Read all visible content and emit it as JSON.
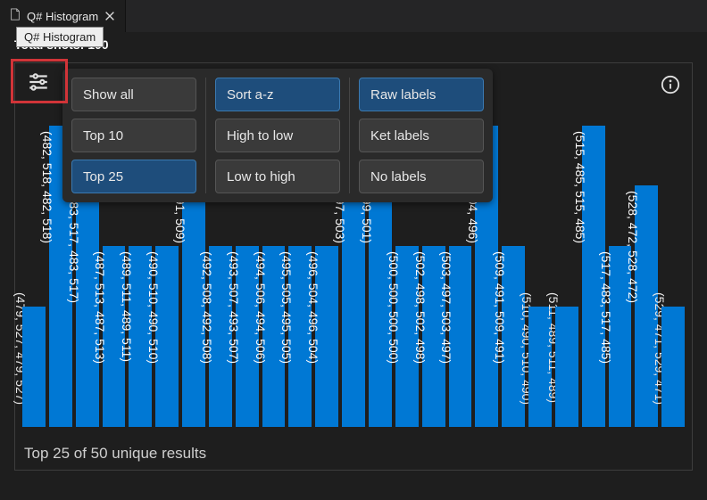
{
  "tab": {
    "title": "Q# Histogram"
  },
  "tooltip": "Q# Histogram",
  "shots_label": "Total shots:",
  "shots_value": "100",
  "panel": {
    "groups": [
      {
        "buttons": [
          {
            "label": "Show all",
            "selected": false,
            "name": "filter-show-all"
          },
          {
            "label": "Top 10",
            "selected": false,
            "name": "filter-top-10"
          },
          {
            "label": "Top 25",
            "selected": true,
            "name": "filter-top-25"
          }
        ]
      },
      {
        "buttons": [
          {
            "label": "Sort a-z",
            "selected": true,
            "name": "sort-az"
          },
          {
            "label": "High to low",
            "selected": false,
            "name": "sort-high-low"
          },
          {
            "label": "Low to high",
            "selected": false,
            "name": "sort-low-high"
          }
        ]
      },
      {
        "buttons": [
          {
            "label": "Raw labels",
            "selected": true,
            "name": "labels-raw"
          },
          {
            "label": "Ket labels",
            "selected": false,
            "name": "labels-ket"
          },
          {
            "label": "No labels",
            "selected": false,
            "name": "labels-none"
          }
        ]
      }
    ]
  },
  "footer": "Top 25 of 50 unique results",
  "chart_data": {
    "type": "bar",
    "title": "Q# Histogram",
    "xlabel": "",
    "ylabel": "",
    "ylim": [
      0,
      5
    ],
    "categories": [
      "(479, 527, 479, 527)",
      "(482, 518, 482, 518)",
      "(483, 517, 483, 517)",
      "(487, 513, 487, 513)",
      "(489, 511, 489, 511)",
      "(490, 510, 490, 510)",
      "(491, 509, 491, 509)",
      "(492, 508, 492, 508)",
      "(493, 507, 493, 507)",
      "(494, 506, 494, 506)",
      "(495, 505, 495, 505)",
      "(496, 504, 496, 504)",
      "(497, 503, 497, 503)",
      "(499, 501, 499, 501)",
      "(500, 500, 500, 500)",
      "(502, 498, 502, 498)",
      "(503, 497, 503, 497)",
      "(504, 496, 504, 496)",
      "(509, 491, 509, 491)",
      "(510, 490, 510, 490)",
      "(511, 489, 511, 489)",
      "(515, 485, 515, 485)",
      "(517, 483, 517, 485)",
      "(528, 472, 528, 472)",
      "(529, 471, 529, 471)"
    ],
    "values": [
      2,
      5,
      4,
      3,
      3,
      3,
      5,
      3,
      3,
      3,
      3,
      3,
      5,
      5,
      3,
      3,
      3,
      5,
      3,
      2,
      2,
      5,
      3,
      4,
      2
    ],
    "label_inside": [
      false,
      true,
      true,
      true,
      true,
      true,
      true,
      true,
      true,
      true,
      true,
      true,
      true,
      true,
      true,
      true,
      true,
      true,
      true,
      false,
      false,
      true,
      true,
      true,
      false
    ]
  }
}
